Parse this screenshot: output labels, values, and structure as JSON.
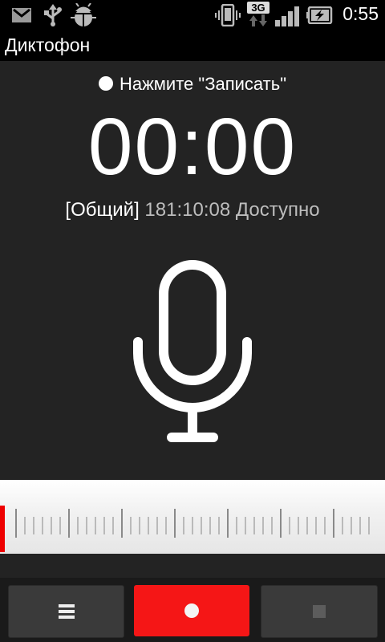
{
  "status_bar": {
    "network": "3G",
    "time": "0:55",
    "icons": [
      "gmail-icon",
      "usb-icon",
      "android-debug-icon",
      "vibrate-icon",
      "network-3g-icon",
      "signal-icon",
      "battery-charging-icon"
    ]
  },
  "app": {
    "title": "Диктофон"
  },
  "recorder": {
    "prompt": "Нажмите \"Записать\"",
    "timer": "00:00",
    "storage_label": "[Общий]",
    "available": "181:10:08 Доступно"
  },
  "controls": {
    "menu_icon": "menu-icon",
    "record_icon": "record-icon",
    "stop_icon": "stop-icon"
  },
  "colors": {
    "background": "#232323",
    "record": "#f51616",
    "level_marker": "#e00000"
  }
}
